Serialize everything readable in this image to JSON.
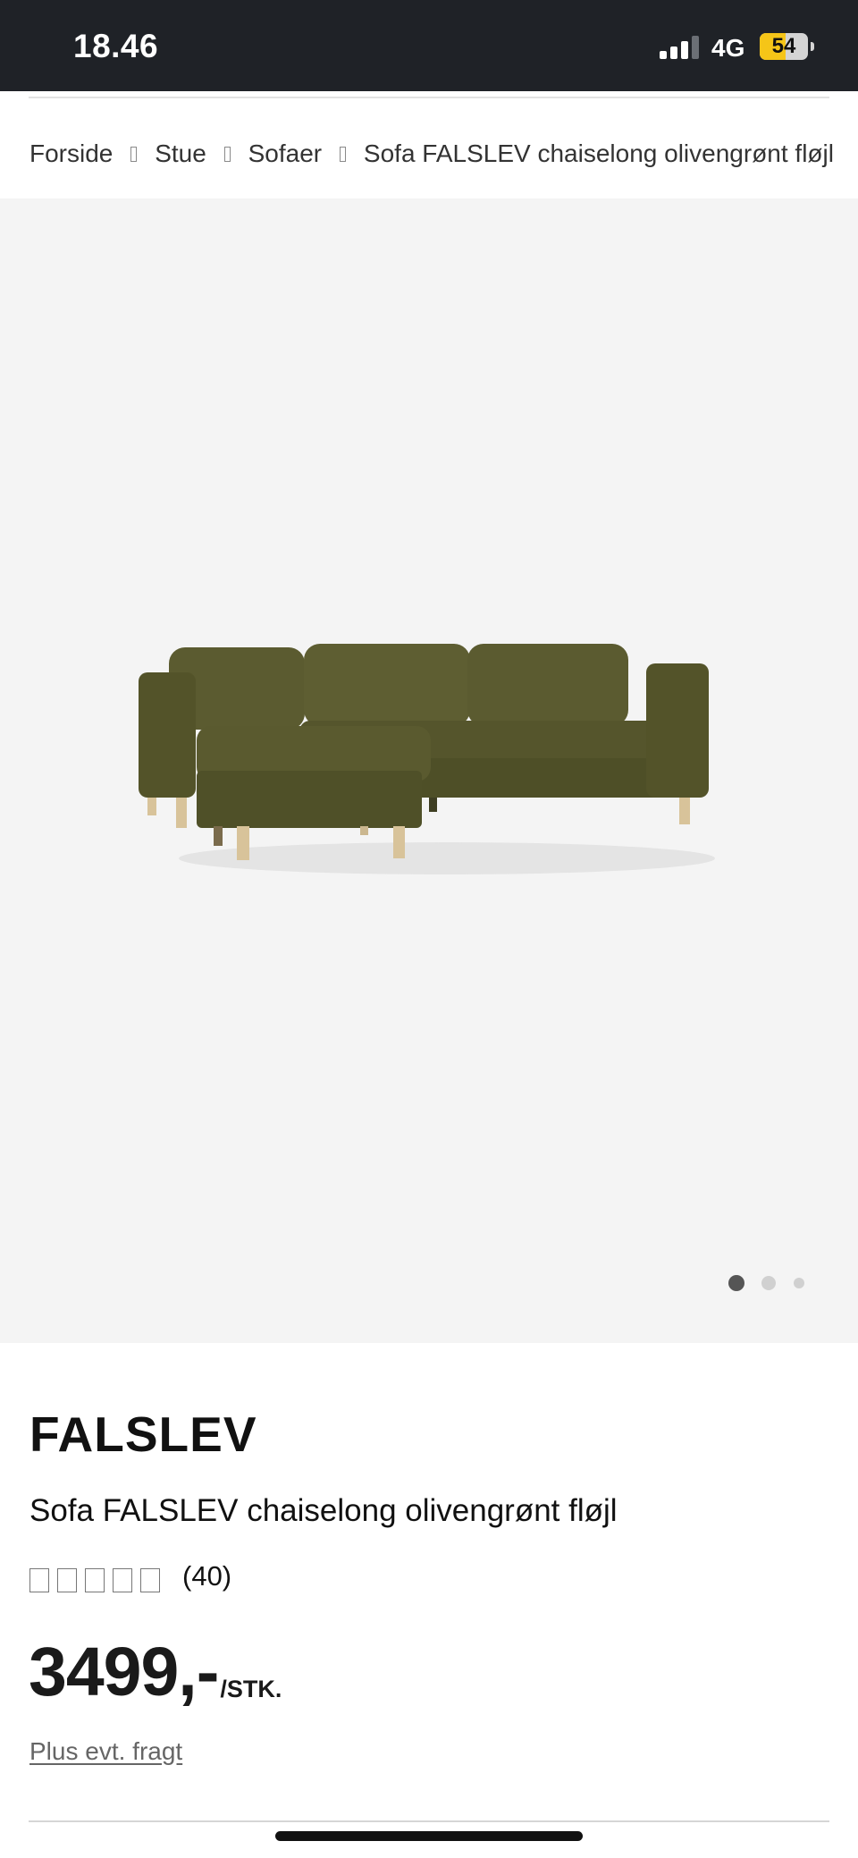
{
  "status_bar": {
    "time": "18.46",
    "network": "4G",
    "battery_level": "54",
    "battery_fraction": 0.54,
    "battery_color": "#f5c518",
    "signal_icon": "cellular-signal-icon"
  },
  "breadcrumb": {
    "items": [
      "Forside",
      "Stue",
      "Sofaer",
      "Sofa FALSLEV chaiselong olivengrønt fløjl"
    ],
    "separator_icon": "chevron-right-icon"
  },
  "gallery": {
    "image_alt": "Sofa FALSLEV chaiselong olivengrønt fløjl",
    "slide_count": 3,
    "active_slide": 1,
    "colors": {
      "background": "#f4f4f4",
      "sofa": "#5a5a2f",
      "legs": "#d8c39a",
      "dot_active": "#555555",
      "dot_inactive": "#d0d0d0"
    }
  },
  "product": {
    "brand": "FALSLEV",
    "name": "Sofa FALSLEV chaiselong olivengrønt fløjl",
    "rating_count": "(40)",
    "rating_icon": "star-icon",
    "price": "3499,-",
    "unit": "/STK.",
    "shipping_link": "Plus evt. fragt"
  }
}
